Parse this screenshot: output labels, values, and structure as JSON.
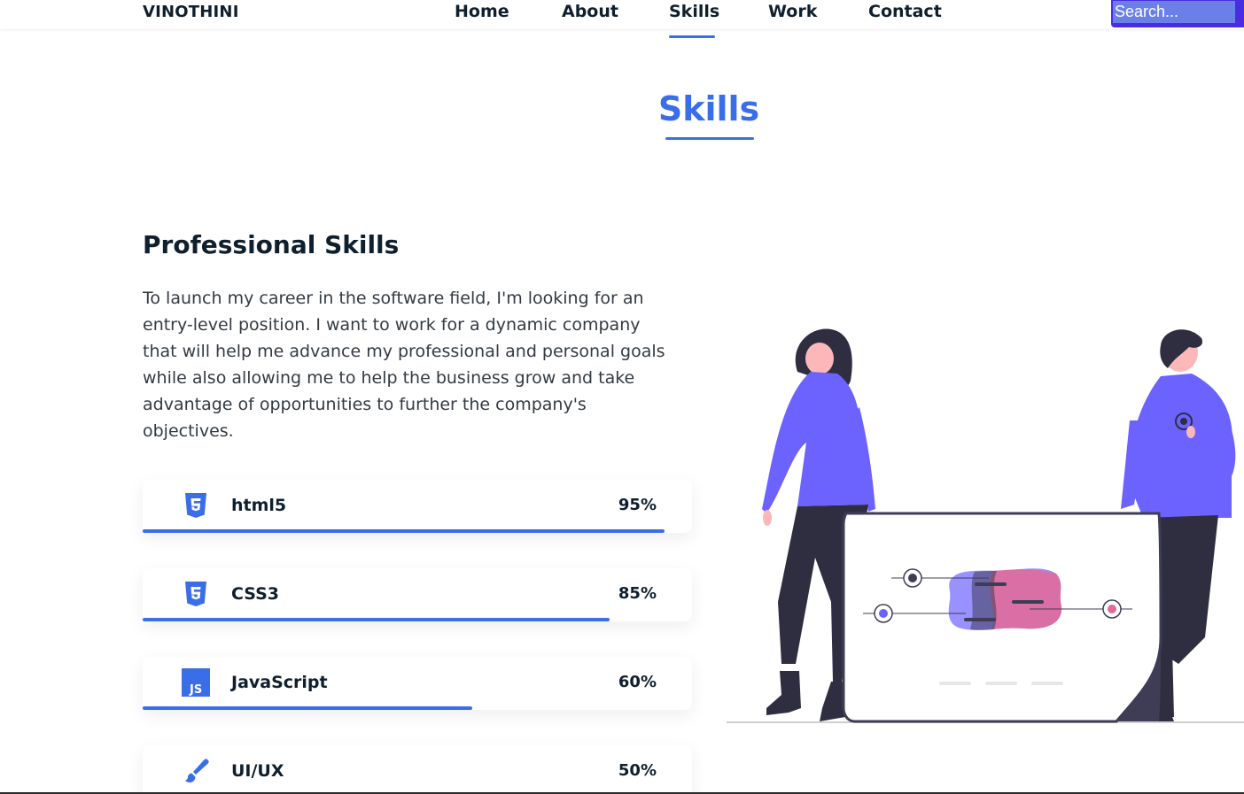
{
  "header": {
    "logo": "VINOTHINI",
    "nav": [
      {
        "label": "Home"
      },
      {
        "label": "About"
      },
      {
        "label": "Skills",
        "active": true
      },
      {
        "label": "Work"
      },
      {
        "label": "Contact"
      }
    ],
    "search": {
      "placeholder": "Search..."
    }
  },
  "skills_section": {
    "title": "Skills",
    "subheading": "Professional Skills",
    "paragraph": "To launch my career in the software field, I'm looking for an entry-level position. I want to work for a dynamic company that will help me advance my professional and personal goals while also allowing me to help the business grow and take advantage of opportunities to further the company's objectives.",
    "skills": [
      {
        "name": "html5",
        "percent_label": "95%",
        "level": 0.95,
        "icon": "html5-icon"
      },
      {
        "name": "CSS3",
        "percent_label": "85%",
        "level": 0.85,
        "icon": "css3-icon"
      },
      {
        "name": "JavaScript",
        "percent_label": "60%",
        "level": 0.6,
        "icon": "javascript-icon"
      },
      {
        "name": "UI/UX",
        "percent_label": "50%",
        "level": 0.5,
        "icon": "brush-icon"
      }
    ]
  },
  "colors": {
    "accent": "#3a6ee8",
    "text_dark": "#0f1f2e",
    "illustration_purple": "#6c63ff",
    "illustration_pink": "#e06b9a"
  }
}
